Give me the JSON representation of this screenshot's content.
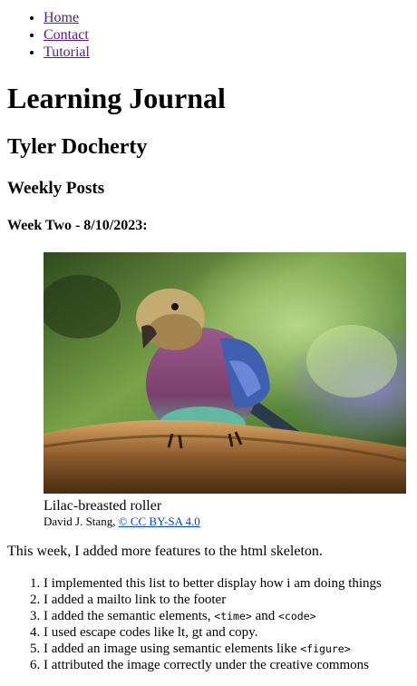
{
  "nav": {
    "home": "Home",
    "contact": "Contact",
    "tutorial": "Tutorial"
  },
  "header": {
    "title": "Learning Journal",
    "author": "Tyler Docherty",
    "section": "Weekly Posts"
  },
  "post": {
    "heading": "Week Two - 8/10/2023:",
    "figure": {
      "caption": "Lilac-breasted roller",
      "credit_author": "David J. Stang, ",
      "credit_license": "© CC BY-SA 4.0"
    },
    "intro": "This week, I added more features to the html skeleton.",
    "list": {
      "item1": "I implemented this list to better display how i am doing things",
      "item2": "I added a mailto link to the footer",
      "item3_prefix": "I added the semantic elements, ",
      "item3_code1": "<time>",
      "item3_mid": " and ",
      "item3_code2": "<code>",
      "item4": "I used escape codes like lt, gt and copy.",
      "item5_prefix": "I added an image using semantic elements like ",
      "item5_code": "<figure>",
      "item6": "I attributed the image correctly under the creative commons"
    }
  },
  "colors": {
    "link_visited": "#551a8b",
    "link_credit": "#0645ad"
  }
}
